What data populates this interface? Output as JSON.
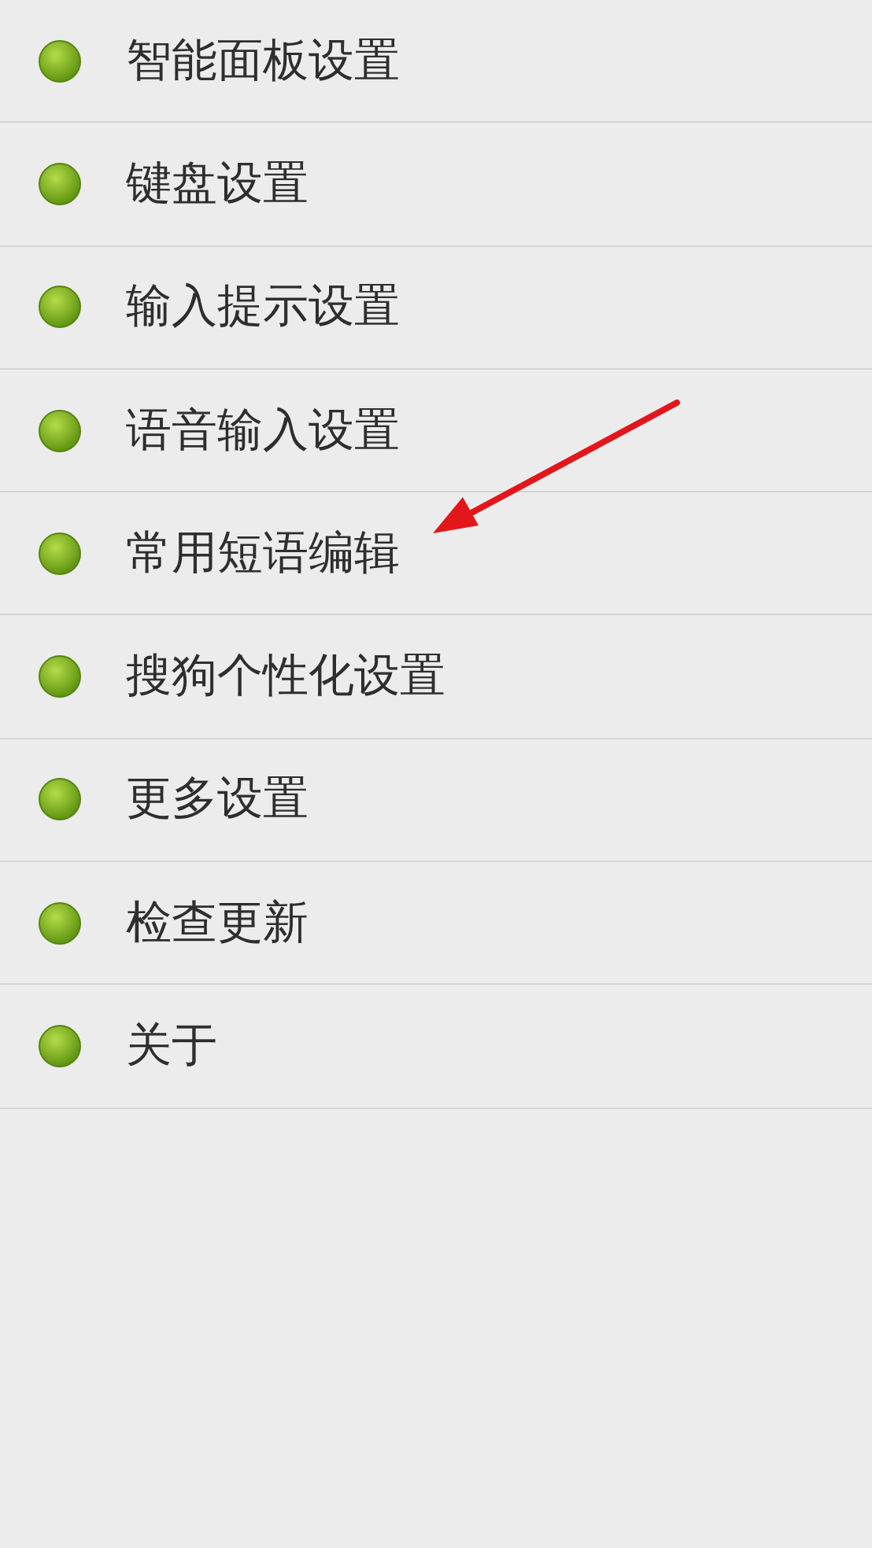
{
  "settings_menu": {
    "items": [
      {
        "label": "智能面板设置"
      },
      {
        "label": "键盘设置"
      },
      {
        "label": "输入提示设置"
      },
      {
        "label": "语音输入设置"
      },
      {
        "label": "常用短语编辑"
      },
      {
        "label": "搜狗个性化设置"
      },
      {
        "label": "更多设置"
      },
      {
        "label": "检查更新"
      },
      {
        "label": "关于"
      }
    ]
  }
}
